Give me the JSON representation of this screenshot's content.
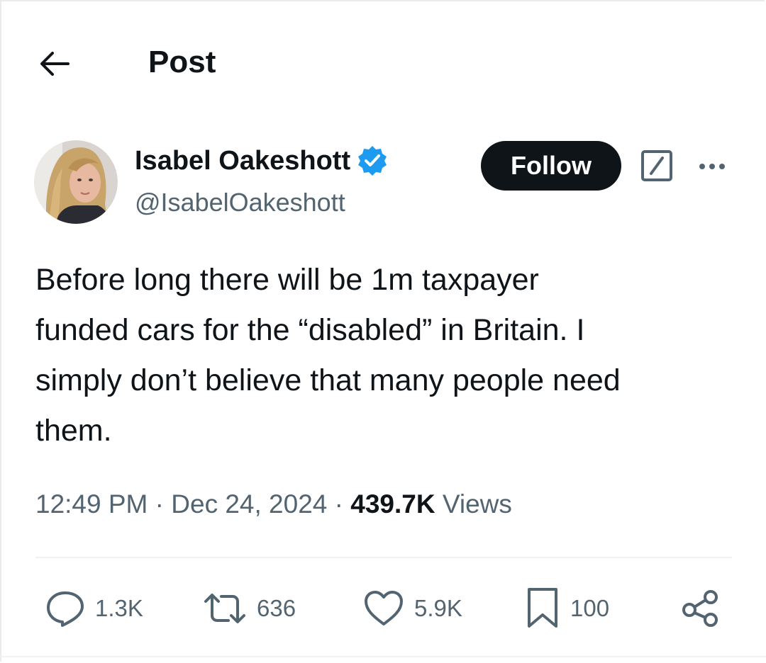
{
  "header": {
    "title": "Post",
    "back_icon": "arrow-left-icon"
  },
  "author": {
    "name": "Isabel Oakeshott",
    "handle": "@IsabelOakeshott",
    "verified": true,
    "verified_color": "#1d9bf0"
  },
  "follow_label": "Follow",
  "tweet": {
    "text": "Before long there will be 1m taxpayer\nfunded cars for the “disabled” in Britain. I\nsimply don’t believe that many people need\nthem."
  },
  "meta": {
    "time": "12:49 PM",
    "separator": "·",
    "date": "Dec 24, 2024",
    "views_count": "439.7K",
    "views_label": "Views"
  },
  "actions": {
    "replies": "1.3K",
    "reposts": "636",
    "likes": "5.9K",
    "bookmarks": "100"
  },
  "colors": {
    "text": "#0f1419",
    "secondary": "#536471",
    "follow_bg": "#0f1419"
  }
}
